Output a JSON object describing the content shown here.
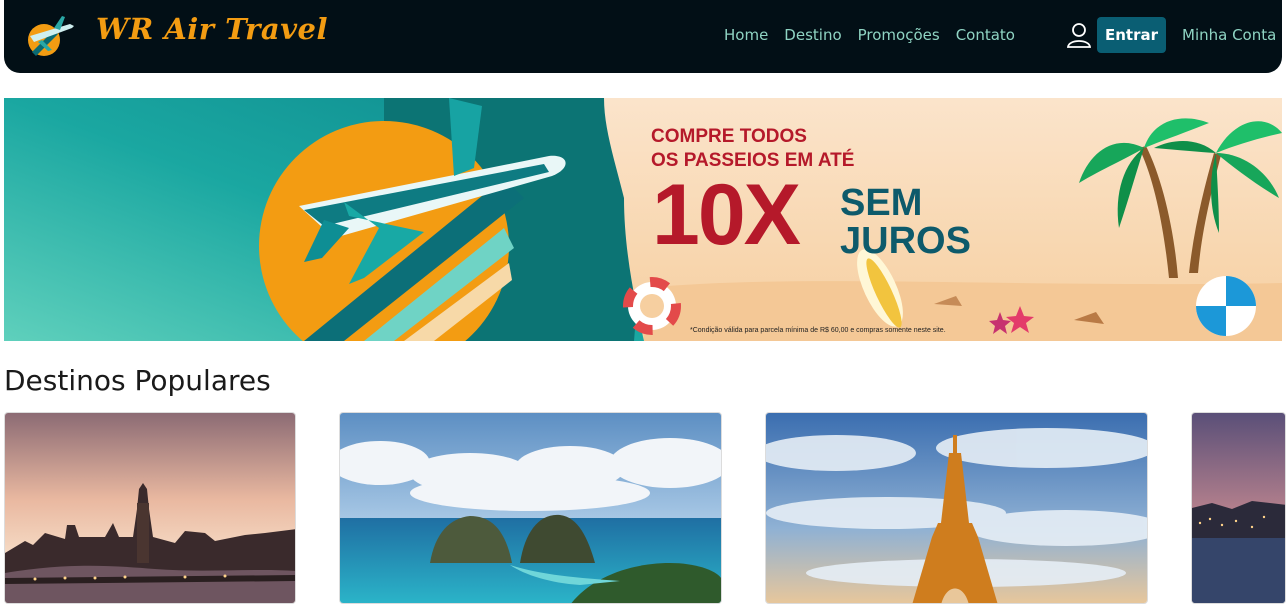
{
  "brand": {
    "name": "WR Air Travel",
    "logo_icon": "airplane-sun-logo"
  },
  "nav": {
    "links": [
      "Home",
      "Destino",
      "Promoções",
      "Contato"
    ],
    "user_icon": "user-icon",
    "login_label": "Entrar",
    "account_label": "Minha Conta"
  },
  "banner": {
    "line1_prefix": "COMPRE ",
    "line1_bold": "TODOS",
    "line2": "OS PASSEIOS EM ATÉ",
    "big": "10X",
    "sem": "SEM",
    "juros": "JUROS",
    "condition": "*Condição válida para parcela mínima de R$ 60,00 e compras somente neste site."
  },
  "destinos": {
    "title": "Destinos Populares",
    "cards": [
      {
        "image": "london-skyline"
      },
      {
        "image": "fernando-de-noronha-islands"
      },
      {
        "image": "eiffel-tower-paris"
      },
      {
        "image": "coastal-city-night"
      }
    ]
  },
  "colors": {
    "navbar_bg": "#020f16",
    "nav_link": "#8fd4c3",
    "brand": "#f39c12",
    "button_bg": "#0a5e73",
    "promo_red": "#b5192a",
    "promo_teal": "#0d5a6b"
  }
}
